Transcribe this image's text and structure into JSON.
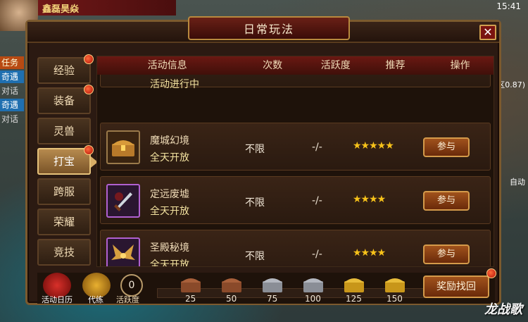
{
  "hud": {
    "player_name": "鑫磊昊焱",
    "clock": "15:41",
    "side_task": "任务",
    "side_items": [
      "奇遇",
      "对话",
      "对话",
      "奇遇",
      "对话"
    ],
    "right_coord": "社区0.87)",
    "right_auto": "自动"
  },
  "panel": {
    "title": "日常玩法",
    "close_icon": "close-icon"
  },
  "tabs": [
    {
      "label": "经验",
      "badge": true
    },
    {
      "label": "装备",
      "badge": true
    },
    {
      "label": "灵兽",
      "badge": false
    },
    {
      "label": "打宝",
      "badge": true,
      "active": true
    },
    {
      "label": "跨服",
      "badge": false
    },
    {
      "label": "荣耀",
      "badge": false
    },
    {
      "label": "竞技",
      "badge": false
    }
  ],
  "table": {
    "headers": {
      "info": "活动信息",
      "count": "次数",
      "activity": "活跃度",
      "recommend": "推荐",
      "action": "操作"
    },
    "partial_row_time": "活动进行中",
    "rows": [
      {
        "name": "魔城幻境",
        "time": "全天开放",
        "count": "不限",
        "activity": "-/-",
        "stars": "★★★★★",
        "rating": 5,
        "action": "参与",
        "icon": "treasure-chest-icon"
      },
      {
        "name": "定远废墟",
        "time": "全天开放",
        "count": "不限",
        "activity": "-/-",
        "stars": "★★★★",
        "rating": 4,
        "action": "参与",
        "icon": "sword-icon"
      },
      {
        "name": "圣殿秘境",
        "time": "全天开放",
        "count": "不限",
        "activity": "-/-",
        "stars": "★★★★",
        "rating": 4,
        "action": "参与",
        "icon": "golden-wings-icon"
      }
    ]
  },
  "bottom": {
    "calendar_label": "活动日历",
    "daily_label": "代练",
    "activity_value": "0",
    "activity_label": "活跃度",
    "milestones": [
      "25",
      "50",
      "75",
      "100",
      "125",
      "150"
    ],
    "reward_button": "奖励找回"
  },
  "watermark": "龙战歌"
}
